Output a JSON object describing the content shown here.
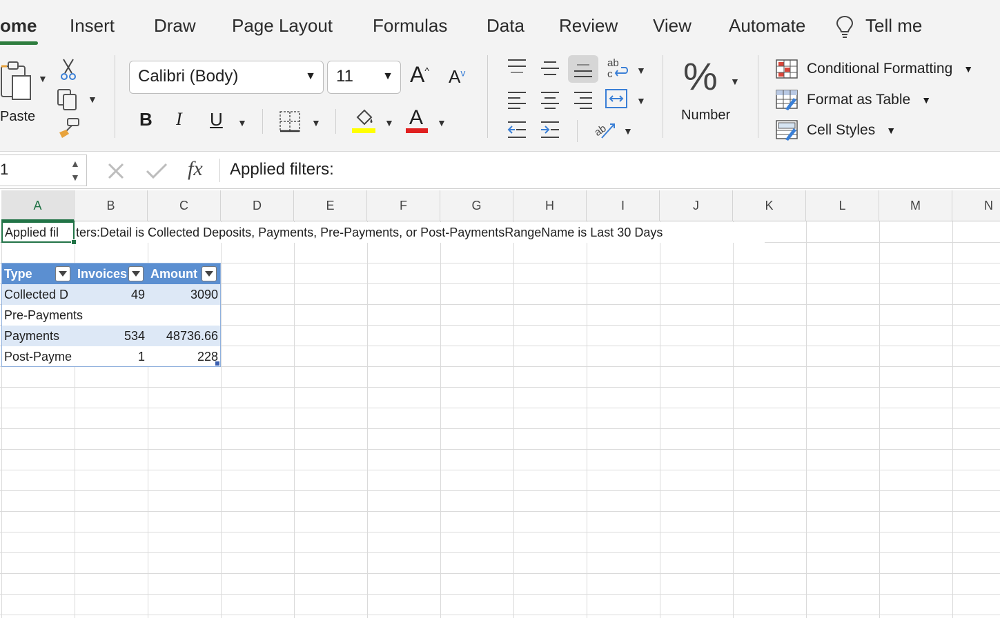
{
  "ribbon_tabs": [
    "ome",
    "Insert",
    "Draw",
    "Page Layout",
    "Formulas",
    "Data",
    "Review",
    "View",
    "Automate",
    "Tell me"
  ],
  "clipboard": {
    "paste_label": "Paste"
  },
  "font": {
    "name": "Calibri (Body)",
    "size": "11"
  },
  "format_buttons": {
    "bold": "B",
    "italic": "I",
    "underline": "U",
    "font_color_glyph": "A",
    "increase_font_glyph": "A",
    "decrease_font_glyph": "A"
  },
  "number": {
    "label": "Number",
    "glyph": "%"
  },
  "styles": {
    "conditional_formatting": "Conditional Formatting",
    "format_as_table": "Format as Table",
    "cell_styles": "Cell Styles"
  },
  "formula_bar": {
    "name_box": "1",
    "fx_label": "fx",
    "content": "Applied filters:"
  },
  "columns": [
    "A",
    "B",
    "C",
    "D",
    "E",
    "F",
    "G",
    "H",
    "I",
    "J",
    "K",
    "L",
    "M",
    "N"
  ],
  "sheet": {
    "a1_part1": "Applied fil",
    "a1_part2": "ters:Detail is Collected Deposits, Payments, Pre-Payments, or Post-PaymentsRangeName is Last 30 Days",
    "table_headers": [
      "Type",
      "Invoices",
      "Amount"
    ],
    "rows": [
      {
        "type": "Collected D",
        "invoices": "49",
        "amount": "3090"
      },
      {
        "type": "Pre-Payments",
        "invoices": "",
        "amount": ""
      },
      {
        "type": "Payments",
        "invoices": "534",
        "amount": "48736.66"
      },
      {
        "type": "Post-Payme",
        "invoices": "1",
        "amount": "228"
      }
    ]
  },
  "colors": {
    "accent": "#217346",
    "table_header": "#5b8fd1",
    "table_band": "#dde8f6",
    "highlight": "#ffff00",
    "font_color": "#e02020"
  }
}
